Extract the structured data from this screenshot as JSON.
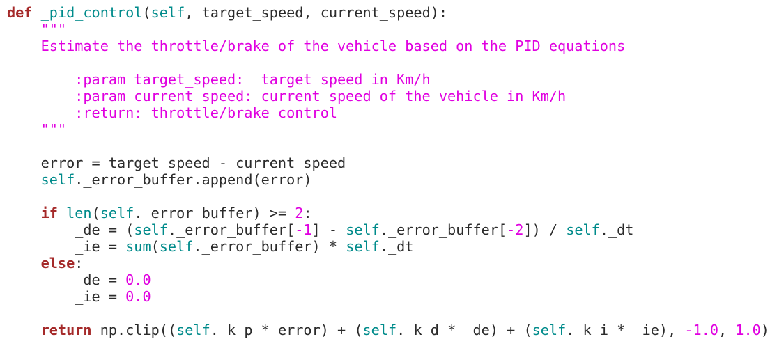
{
  "editor": {
    "colors": {
      "background": "#ffffff",
      "text": "#2b2b2b",
      "keyword": "#a52a2a",
      "identifier": "#008b8b",
      "string": "#e000e0",
      "number": "#e000e0"
    },
    "lines": [
      [
        [
          "kw",
          "def"
        ],
        [
          "txt",
          " "
        ],
        [
          "fn",
          "_pid_control"
        ],
        [
          "txt",
          "("
        ],
        [
          "self",
          "self"
        ],
        [
          "txt",
          ", target_speed, current_speed):"
        ]
      ],
      [
        [
          "str",
          "    \"\"\""
        ]
      ],
      [
        [
          "str",
          "    Estimate the throttle/brake of the vehicle based on the PID equations"
        ]
      ],
      [
        [
          "str",
          ""
        ]
      ],
      [
        [
          "str",
          "        :param target_speed:  target speed in Km/h"
        ]
      ],
      [
        [
          "str",
          "        :param current_speed: current speed of the vehicle in Km/h"
        ]
      ],
      [
        [
          "str",
          "        :return: throttle/brake control"
        ]
      ],
      [
        [
          "str",
          "    \"\"\""
        ]
      ],
      [
        [
          "txt",
          ""
        ]
      ],
      [
        [
          "txt",
          "    error = target_speed - current_speed"
        ]
      ],
      [
        [
          "txt",
          "    "
        ],
        [
          "self",
          "self"
        ],
        [
          "txt",
          "._error_buffer.append(error)"
        ]
      ],
      [
        [
          "txt",
          ""
        ]
      ],
      [
        [
          "txt",
          "    "
        ],
        [
          "kw",
          "if"
        ],
        [
          "txt",
          " "
        ],
        [
          "builtin",
          "len"
        ],
        [
          "txt",
          "("
        ],
        [
          "self",
          "self"
        ],
        [
          "txt",
          "._error_buffer) >= "
        ],
        [
          "num",
          "2"
        ],
        [
          "txt",
          ":"
        ]
      ],
      [
        [
          "txt",
          "        _de = ("
        ],
        [
          "self",
          "self"
        ],
        [
          "txt",
          "._error_buffer["
        ],
        [
          "num",
          "-1"
        ],
        [
          "txt",
          "] - "
        ],
        [
          "self",
          "self"
        ],
        [
          "txt",
          "._error_buffer["
        ],
        [
          "num",
          "-2"
        ],
        [
          "txt",
          "]) / "
        ],
        [
          "self",
          "self"
        ],
        [
          "txt",
          "._dt"
        ]
      ],
      [
        [
          "txt",
          "        _ie = "
        ],
        [
          "builtin",
          "sum"
        ],
        [
          "txt",
          "("
        ],
        [
          "self",
          "self"
        ],
        [
          "txt",
          "._error_buffer) * "
        ],
        [
          "self",
          "self"
        ],
        [
          "txt",
          "._dt"
        ]
      ],
      [
        [
          "txt",
          "    "
        ],
        [
          "kw",
          "else"
        ],
        [
          "txt",
          ":"
        ]
      ],
      [
        [
          "txt",
          "        _de = "
        ],
        [
          "num",
          "0.0"
        ]
      ],
      [
        [
          "txt",
          "        _ie = "
        ],
        [
          "num",
          "0.0"
        ]
      ],
      [
        [
          "txt",
          ""
        ]
      ],
      [
        [
          "txt",
          "    "
        ],
        [
          "kw",
          "return"
        ],
        [
          "txt",
          " np.clip(("
        ],
        [
          "self",
          "self"
        ],
        [
          "txt",
          "._k_p * error) + ("
        ],
        [
          "self",
          "self"
        ],
        [
          "txt",
          "._k_d * _de) + ("
        ],
        [
          "self",
          "self"
        ],
        [
          "txt",
          "._k_i * _ie), "
        ],
        [
          "num",
          "-1.0"
        ],
        [
          "txt",
          ", "
        ],
        [
          "num",
          "1.0"
        ],
        [
          "txt",
          ")"
        ]
      ]
    ]
  }
}
